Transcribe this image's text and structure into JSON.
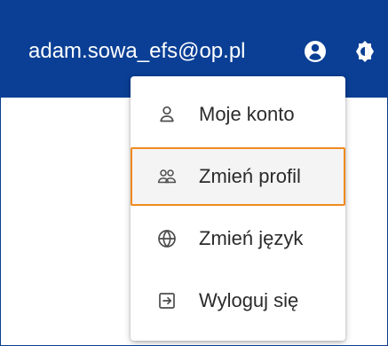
{
  "header": {
    "email": "adam.sowa_efs@op.pl",
    "account_icon": "account-circle-icon",
    "theme_icon": "theme-contrast-icon"
  },
  "menu": {
    "items": [
      {
        "label": "Moje konto",
        "icon": "person-outline-icon"
      },
      {
        "label": "Zmień profil",
        "icon": "people-outline-icon"
      },
      {
        "label": "Zmień język",
        "icon": "globe-icon"
      },
      {
        "label": "Wyloguj się",
        "icon": "logout-icon"
      }
    ]
  },
  "colors": {
    "header": "#0a3f95",
    "active_outline": "#ef8a1f",
    "active_background": "#f4f4f4",
    "text": "#2b2b2b"
  }
}
